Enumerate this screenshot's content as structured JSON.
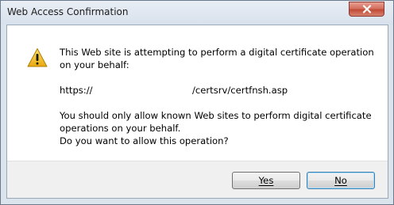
{
  "window": {
    "title": "Web Access Confirmation"
  },
  "message": {
    "line1": "This Web site is attempting to perform a digital certificate operation on your behalf:",
    "url_prefix": "https://",
    "url_suffix": "/certsrv/certfnsh.asp",
    "warning_line1": "You should only allow known Web sites to perform digital certificate",
    "warning_line2": "operations on your behalf.",
    "question": "Do you want to allow this operation?"
  },
  "buttons": {
    "yes_label": "Yes",
    "no_label": "No"
  },
  "icons": {
    "dialog_icon": "warning-icon",
    "close_icon": "close-icon"
  },
  "colors": {
    "warning_yellow": "#f2c21a",
    "close_red": "#c14b36"
  }
}
